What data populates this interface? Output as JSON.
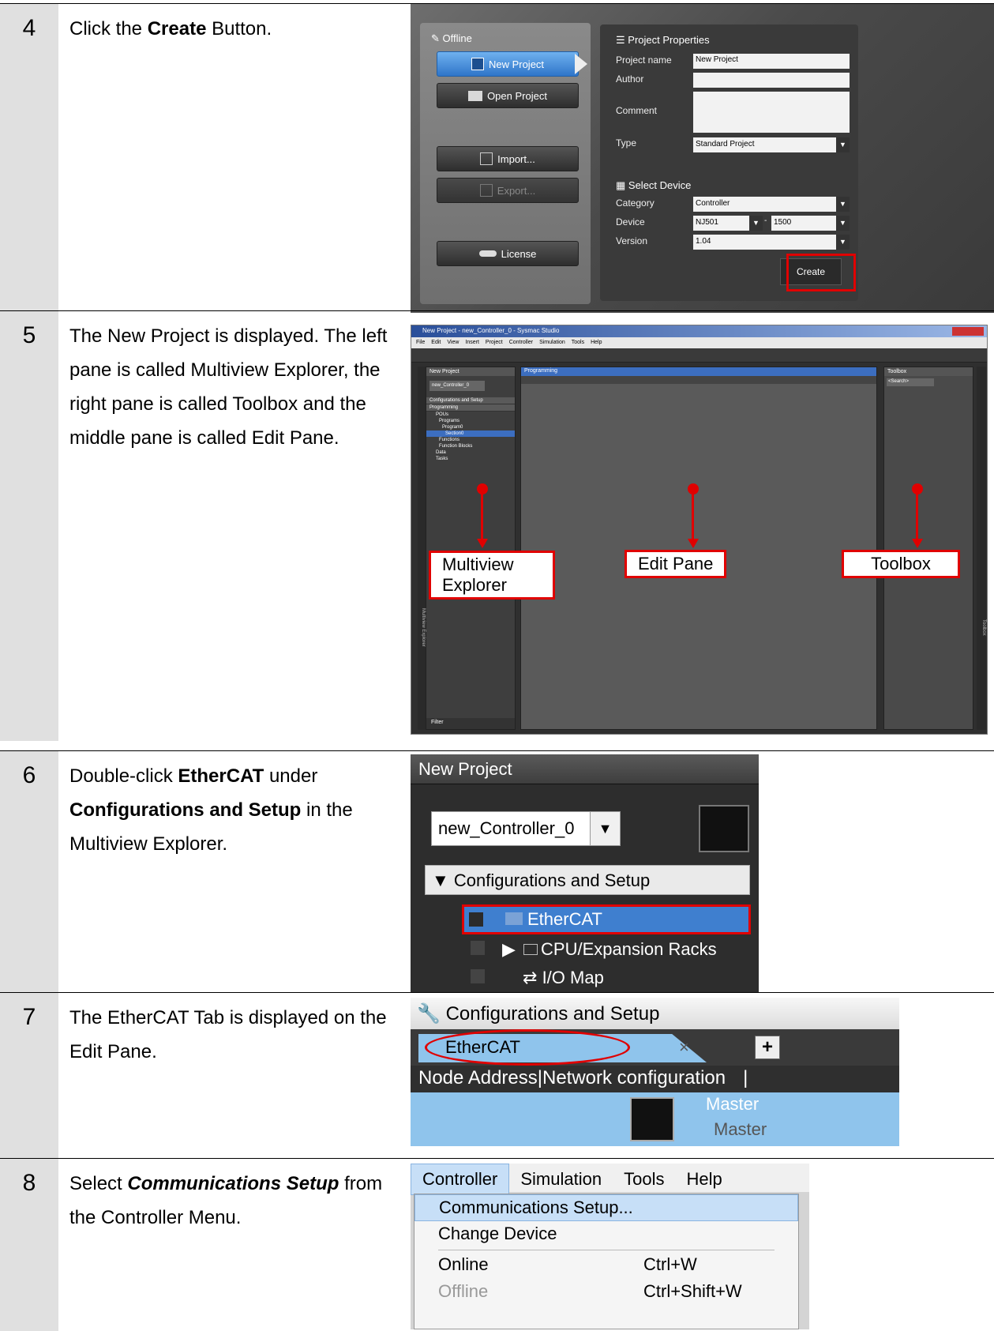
{
  "steps": [
    {
      "num": "4",
      "parts": [
        {
          "t": "Click the "
        },
        {
          "t": "Create",
          "b": true
        },
        {
          "t": " Button."
        }
      ]
    },
    {
      "num": "5",
      "parts": [
        {
          "t": "The New Project is displayed. The left pane is called Multiview Explorer, the right pane is called Toolbox and the middle pane is called Edit Pane."
        }
      ]
    },
    {
      "num": "6",
      "parts": [
        {
          "t": "Double-click "
        },
        {
          "t": "EtherCAT",
          "b": true
        },
        {
          "t": " under "
        },
        {
          "t": "Configurations and Setup",
          "b": true
        },
        {
          "t": " in the Multiview Explorer."
        }
      ]
    },
    {
      "num": "7",
      "parts": [
        {
          "t": "The EtherCAT Tab is displayed on the Edit Pane."
        }
      ]
    },
    {
      "num": "8",
      "parts": [
        {
          "t": "Select "
        },
        {
          "t": "Communications Setup",
          "b": true,
          "i": true
        },
        {
          "t": " from the Controller Menu."
        }
      ]
    }
  ],
  "shot4": {
    "offline": "Offline",
    "new_project": "New Project",
    "open_project": "Open Project",
    "import": "Import...",
    "export": "Export...",
    "license": "License",
    "props_title": "Project Properties",
    "project_name_label": "Project name",
    "project_name_value": "New Project",
    "author_label": "Author",
    "comment_label": "Comment",
    "type_label": "Type",
    "type_value": "Standard Project",
    "select_device": "Select Device",
    "category_label": "Category",
    "category_value": "Controller",
    "device_label": "Device",
    "device_value": "NJ501",
    "device_model": "1500",
    "version_label": "Version",
    "version_value": "1.04",
    "create": "Create"
  },
  "shot5": {
    "title": "New Project - new_Controller_0 - Sysmac Studio",
    "menu": [
      "File",
      "Edit",
      "View",
      "Insert",
      "Project",
      "Controller",
      "Simulation",
      "Tools",
      "Help"
    ],
    "left_header": "New Project",
    "controller": "new_Controller_0",
    "tree": [
      "Configurations and Setup",
      "Programming",
      "POUs",
      "Programs",
      "Program0",
      "Section0",
      "Functions",
      "Function Blocks",
      "Data",
      "Tasks"
    ],
    "tab": "Programming",
    "toolbox": "Toolbox",
    "search": "<Search>",
    "filter": "Filter",
    "left_side": "Multiview Explorer",
    "right_side": "Toolbox",
    "callouts": [
      "Multiview Explorer",
      "Edit Pane",
      "Toolbox"
    ]
  },
  "shot6": {
    "header": "New Project",
    "controller": "new_Controller_0",
    "section": "Configurations and Setup",
    "items": [
      "EtherCAT",
      "CPU/Expansion Racks",
      "I/O Map"
    ]
  },
  "shot7": {
    "header": "Configurations and Setup",
    "tab": "EtherCAT",
    "close": "×",
    "plus": "+",
    "columns": "Node Address|Network configuration",
    "master1": "Master",
    "master2": "Master"
  },
  "shot8": {
    "menubar": [
      "Controller",
      "Simulation",
      "Tools",
      "Help"
    ],
    "items": [
      {
        "label": "Communications Setup...",
        "shortcut": ""
      },
      {
        "label": "Change Device",
        "shortcut": ""
      },
      {
        "label": "Online",
        "shortcut": "Ctrl+W"
      },
      {
        "label": "Offline",
        "shortcut": "Ctrl+Shift+W"
      }
    ]
  }
}
